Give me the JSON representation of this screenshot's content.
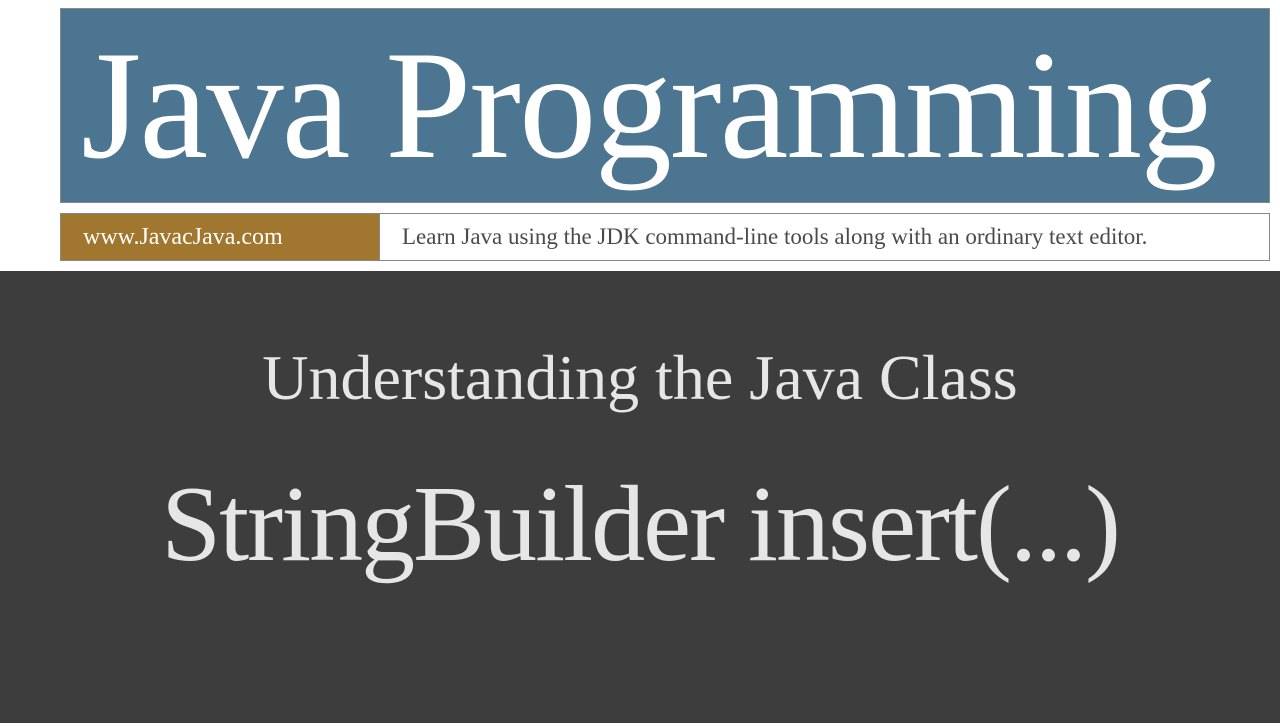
{
  "banner": {
    "title": "Java Programming"
  },
  "subbar": {
    "website": "www.JavacJava.com",
    "tagline": "Learn Java using the JDK command-line tools along with an ordinary text editor."
  },
  "content": {
    "line1": "Understanding the Java Class",
    "line2": "StringBuilder insert(...)"
  }
}
